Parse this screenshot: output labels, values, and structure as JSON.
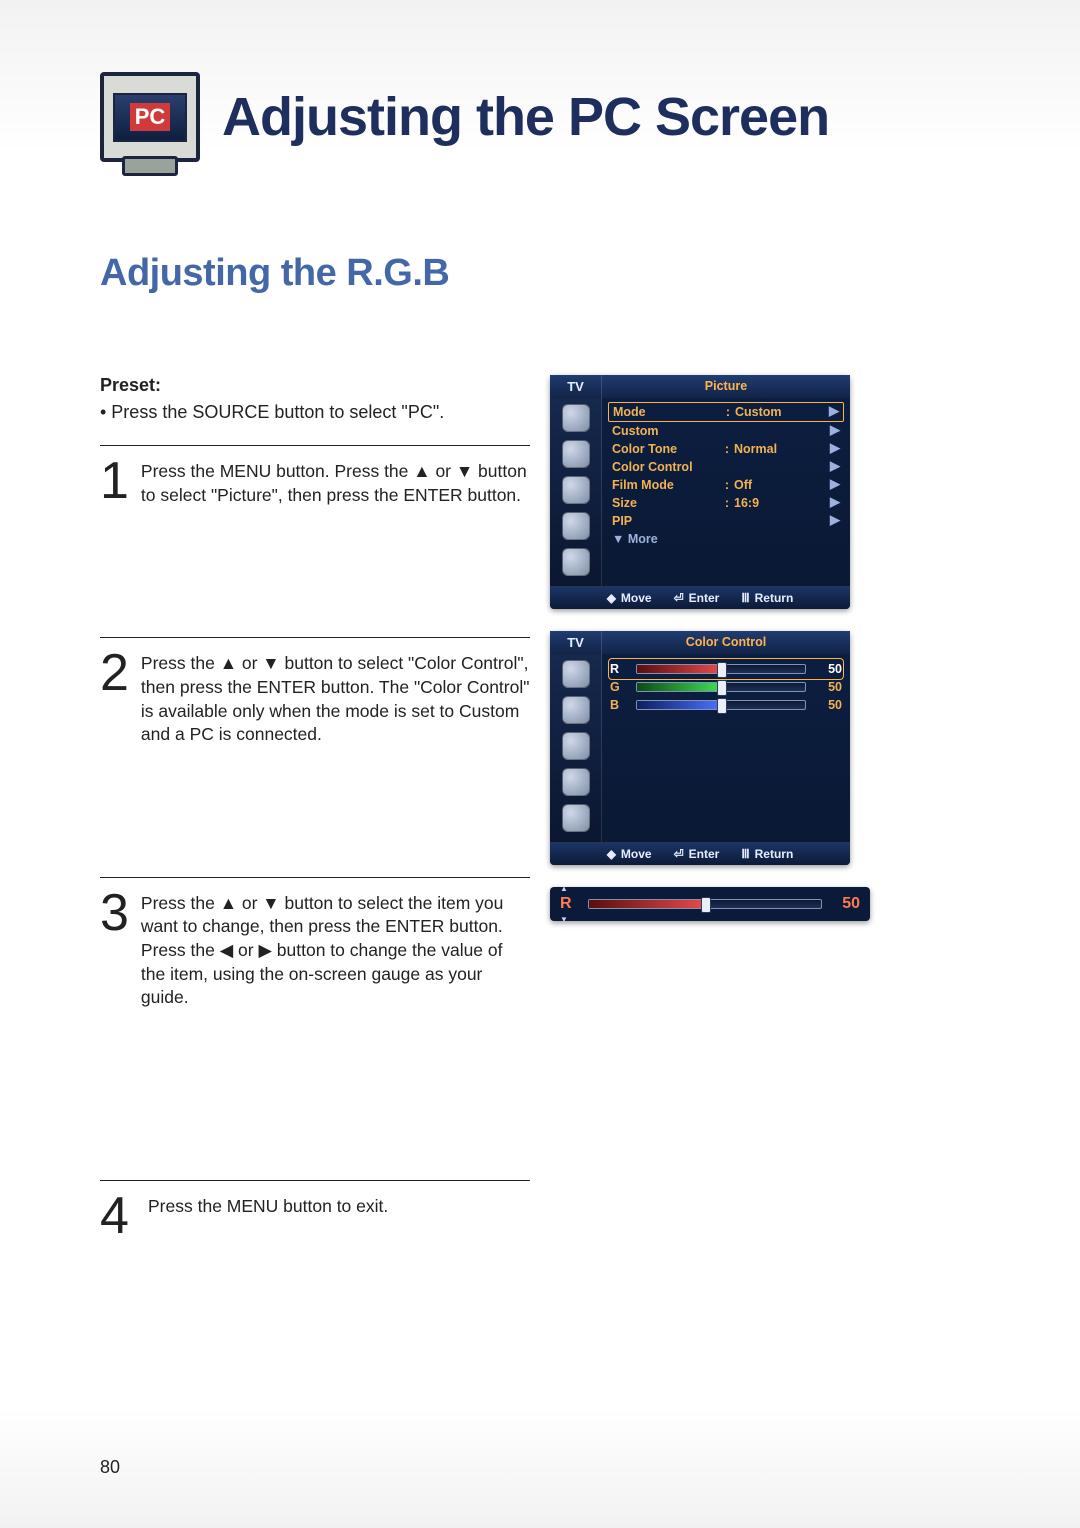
{
  "header": {
    "icon_badge": "PC",
    "main_title": "Adjusting the PC Screen",
    "sub_title": "Adjusting the R.G.B"
  },
  "preset": {
    "label": "Preset:",
    "text": "•  Press the SOURCE button to select \"PC\"."
  },
  "steps": [
    {
      "num": "1",
      "text": "Press the MENU button. Press the ▲ or ▼ button to select \"Picture\", then press the ENTER button."
    },
    {
      "num": "2",
      "text": "Press the ▲ or ▼ button to select \"Color Control\", then press the ENTER button.\nThe \"Color Control\" is available only when the mode is set to Custom and a PC is connected."
    },
    {
      "num": "3",
      "text": "Press the ▲ or ▼ button to select the item you want to change, then press the ENTER button.\nPress the ◀ or ▶ button to change the value of the item, using the on-screen gauge as your guide."
    },
    {
      "num": "4",
      "text": "Press the MENU button to exit."
    }
  ],
  "osd_picture": {
    "tv_label": "TV",
    "title": "Picture",
    "rows": [
      {
        "label": "Mode",
        "value": "Custom",
        "selected": true
      },
      {
        "label": "Custom",
        "value": ""
      },
      {
        "label": "Color Tone",
        "value": "Normal"
      },
      {
        "label": "Color Control",
        "value": ""
      },
      {
        "label": "Film Mode",
        "value": "Off"
      },
      {
        "label": "Size",
        "value": "16:9"
      },
      {
        "label": "PIP",
        "value": ""
      }
    ],
    "more": "▼ More",
    "footer": {
      "move": "Move",
      "enter": "Enter",
      "return": "Return"
    }
  },
  "osd_color": {
    "tv_label": "TV",
    "title": "Color Control",
    "channels": [
      {
        "label": "R",
        "value": "50",
        "selected": true
      },
      {
        "label": "G",
        "value": "50"
      },
      {
        "label": "B",
        "value": "50"
      }
    ],
    "footer": {
      "move": "Move",
      "enter": "Enter",
      "return": "Return"
    }
  },
  "gauge": {
    "label": "R",
    "value": "50"
  },
  "page_number": "80"
}
